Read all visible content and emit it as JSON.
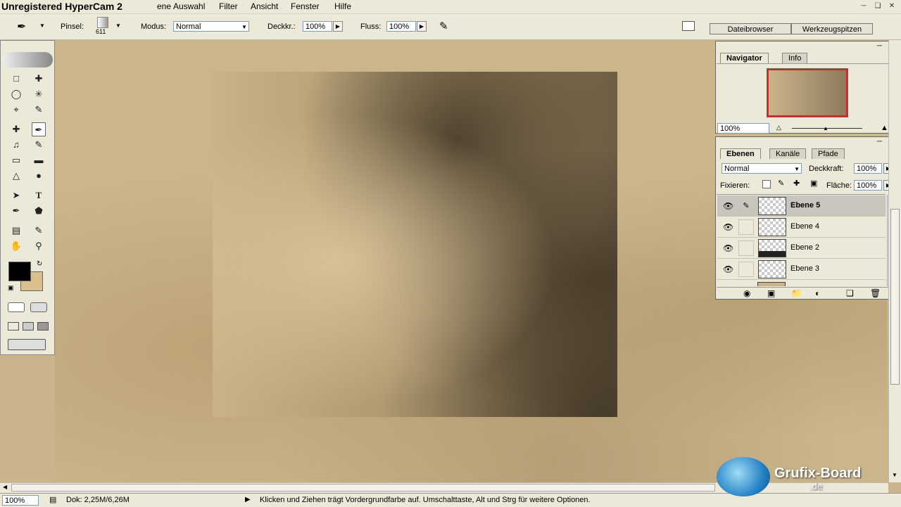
{
  "menubar": {
    "watermark": "Unregistered HyperCam 2",
    "items": [
      "Ebene",
      "Auswahl",
      "Filter",
      "Ansicht",
      "Fenster",
      "Hilfe"
    ],
    "ebene_visible": "ene"
  },
  "options": {
    "pinsel_label": "Pinsel:",
    "pinsel_size": "611",
    "modus_label": "Modus:",
    "modus_value": "Normal",
    "deckkr_label": "Deckkr.:",
    "deckkr_value": "100%",
    "fluss_label": "Fluss:",
    "fluss_value": "100%",
    "tab_dateibrowser": "Dateibrowser",
    "tab_werkzeugspitzen": "Werkzeugspitzen"
  },
  "navigator": {
    "tab_navigator": "Navigator",
    "tab_info": "Info",
    "zoom": "100%"
  },
  "layers_panel": {
    "tab_ebenen": "Ebenen",
    "tab_kanaele": "Kanäle",
    "tab_pfade": "Pfade",
    "blend_mode": "Normal",
    "deckkraft_label": "Deckkraft:",
    "deckkraft_value": "100%",
    "fixieren_label": "Fixieren:",
    "flaeche_label": "Fläche:",
    "flaeche_value": "100%",
    "layers": [
      {
        "name": "Ebene 5",
        "selected": true
      },
      {
        "name": "Ebene 4",
        "selected": false
      },
      {
        "name": "Ebene 2",
        "selected": false
      },
      {
        "name": "Ebene 3",
        "selected": false
      }
    ]
  },
  "status": {
    "zoom": "100%",
    "doc": "Dok: 2,25M/6,26M",
    "hint": "Klicken und Ziehen trägt Vordergrundfarbe auf. Umschalttaste, Alt und Strg für weitere Optionen."
  },
  "logo": {
    "text": "Grufix-Board",
    "sub": ".de"
  },
  "colors": {
    "foreground": "#000000",
    "background": "#d8bf8c",
    "chrome": "#ece9d8"
  }
}
